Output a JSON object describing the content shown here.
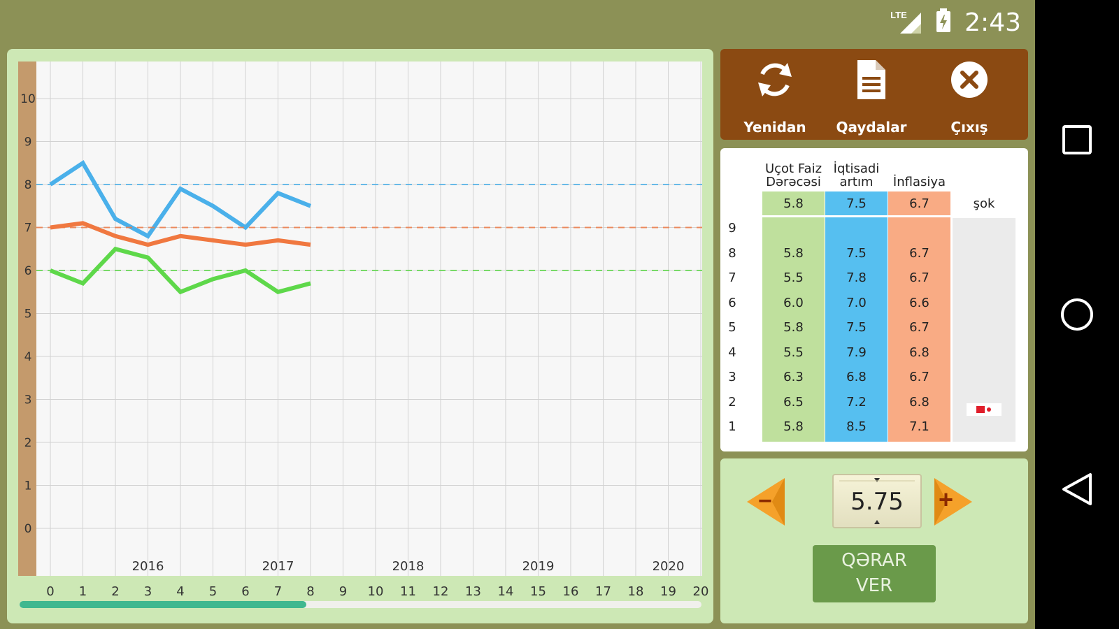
{
  "status_bar": {
    "network": "LTE",
    "time": "2:43"
  },
  "toolbar": {
    "restart_label": "Yenidan",
    "rules_label": "Qaydalar",
    "exit_label": "Çıxış"
  },
  "chart_data": {
    "type": "line",
    "x": [
      0,
      1,
      2,
      3,
      4,
      5,
      6,
      7,
      8
    ],
    "x_ticks": [
      "0",
      "1",
      "2",
      "3",
      "4",
      "5",
      "6",
      "7",
      "8",
      "9",
      "10",
      "11",
      "12",
      "13",
      "14",
      "15",
      "16",
      "17",
      "18",
      "19",
      "20"
    ],
    "y_ticks": [
      "0",
      "1",
      "2",
      "3",
      "4",
      "5",
      "6",
      "7",
      "8",
      "9",
      "10"
    ],
    "year_labels": [
      "2016",
      "2017",
      "2018",
      "2019",
      "2020"
    ],
    "xlim": [
      0,
      20
    ],
    "ylim": [
      0,
      10.5
    ],
    "grid": true,
    "series": [
      {
        "color": "#4ab0ea",
        "values": [
          8.0,
          8.5,
          7.2,
          6.8,
          7.9,
          7.5,
          7.0,
          7.8,
          7.5
        ],
        "target": 8.0
      },
      {
        "color": "#f07840",
        "values": [
          7.0,
          7.1,
          6.8,
          6.6,
          6.8,
          6.7,
          6.6,
          6.7,
          6.6
        ],
        "target": 7.0
      },
      {
        "color": "#5ed84a",
        "values": [
          6.0,
          5.7,
          6.5,
          6.3,
          5.5,
          5.8,
          6.0,
          5.5,
          5.7
        ],
        "target": 6.0
      }
    ]
  },
  "progress": {
    "fraction": 0.42
  },
  "table": {
    "headers": {
      "rate": [
        "Uçot Faiz",
        "Dərəcəsi"
      ],
      "growth": [
        "İqtisadi",
        "artım"
      ],
      "inflation": [
        "İnflasiya"
      ],
      "shock": "şok"
    },
    "targets": {
      "rate": "5.8",
      "growth": "7.5",
      "inflation": "6.7"
    },
    "rows": [
      {
        "n": "9",
        "rate": "",
        "growth": "",
        "inflation": ""
      },
      {
        "n": "8",
        "rate": "5.8",
        "growth": "7.5",
        "inflation": "6.7"
      },
      {
        "n": "7",
        "rate": "5.5",
        "growth": "7.8",
        "inflation": "6.7"
      },
      {
        "n": "6",
        "rate": "6.0",
        "growth": "7.0",
        "inflation": "6.6"
      },
      {
        "n": "5",
        "rate": "5.8",
        "growth": "7.5",
        "inflation": "6.7"
      },
      {
        "n": "4",
        "rate": "5.5",
        "growth": "7.9",
        "inflation": "6.8"
      },
      {
        "n": "3",
        "rate": "6.3",
        "growth": "6.8",
        "inflation": "6.7"
      },
      {
        "n": "2",
        "rate": "6.5",
        "growth": "7.2",
        "inflation": "6.8"
      },
      {
        "n": "1",
        "rate": "5.8",
        "growth": "8.5",
        "inflation": "7.1"
      }
    ],
    "shock_row": "2"
  },
  "control": {
    "value": "5.75",
    "decrease_symbol": "−",
    "increase_symbol": "+",
    "decision_line1": "QƏRAR",
    "decision_line2": "VER"
  }
}
